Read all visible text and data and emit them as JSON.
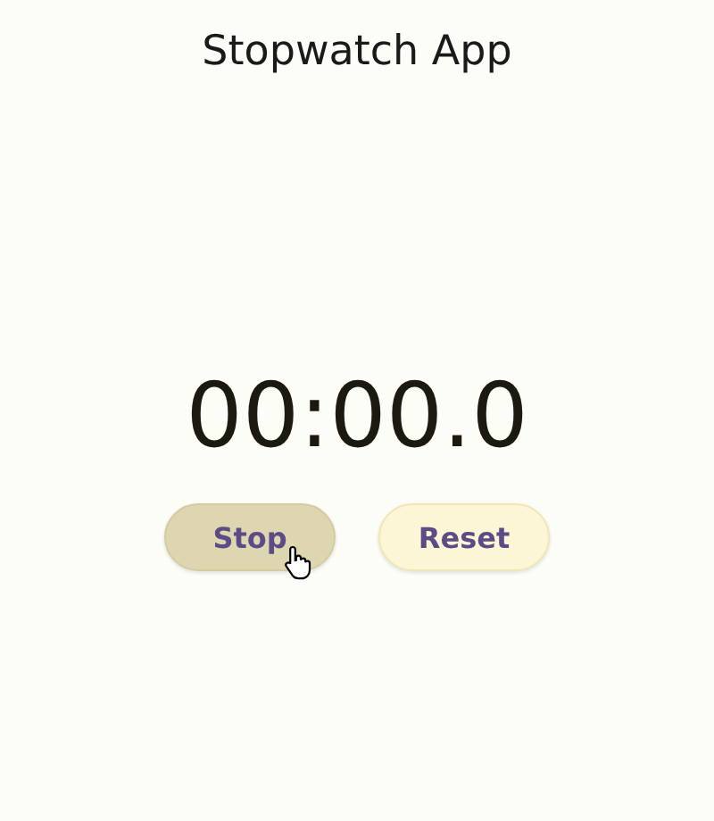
{
  "title": "Stopwatch App",
  "time": "00:00.0",
  "buttons": [
    {
      "label": "Stop",
      "pressed": true
    },
    {
      "label": "Reset",
      "pressed": false
    }
  ]
}
